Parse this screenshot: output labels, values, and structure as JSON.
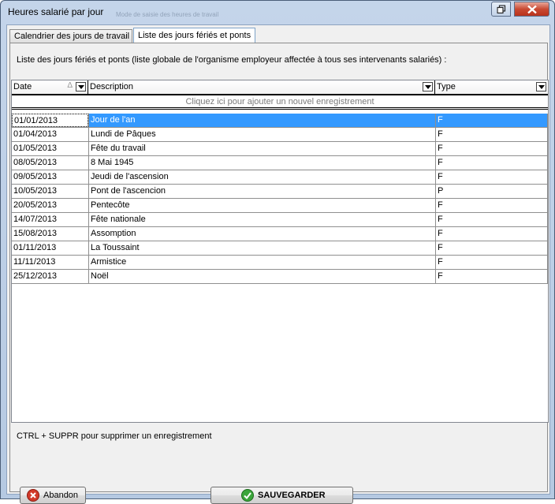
{
  "window": {
    "title": "Heures salarié par jour",
    "ghost_title": "Mode de saisie des heures de travail"
  },
  "tabs": [
    {
      "label": "Calendrier des jours de travail"
    },
    {
      "label": "Liste des jours fériés et ponts"
    }
  ],
  "intro": "Liste des jours fériés et ponts (liste globale de l'organisme employeur affectée à tous ses intervenants salariés) :",
  "grid": {
    "headers": [
      "Date",
      "Description",
      "Type"
    ],
    "sort_indicator": "Δ",
    "new_row_text": "Cliquez ici pour ajouter un nouvel enregistrement",
    "rows": [
      {
        "date": "01/01/2013",
        "description": "Jour de l'an",
        "type": "F",
        "selected": true
      },
      {
        "date": "01/04/2013",
        "description": "Lundi de Pâques",
        "type": "F"
      },
      {
        "date": "01/05/2013",
        "description": "Fête du travail",
        "type": "F"
      },
      {
        "date": "08/05/2013",
        "description": "8 Mai 1945",
        "type": "F"
      },
      {
        "date": "09/05/2013",
        "description": "Jeudi de l'ascension",
        "type": "F"
      },
      {
        "date": "10/05/2013",
        "description": "Pont de l'ascencion",
        "type": "P"
      },
      {
        "date": "20/05/2013",
        "description": "Pentecôte",
        "type": "F"
      },
      {
        "date": "14/07/2013",
        "description": "Fête nationale",
        "type": "F"
      },
      {
        "date": "15/08/2013",
        "description": "Assomption",
        "type": "F"
      },
      {
        "date": "01/11/2013",
        "description": "La Toussaint",
        "type": "F"
      },
      {
        "date": "11/11/2013",
        "description": "Armistice",
        "type": "F"
      },
      {
        "date": "25/12/2013",
        "description": "Noël",
        "type": "F"
      }
    ]
  },
  "hint": "CTRL + SUPPR pour supprimer un enregistrement",
  "buttons": {
    "cancel": "Abandon",
    "save": "SAUVEGARDER"
  },
  "colors": {
    "selection": "#3399ff",
    "close": "#c94a33",
    "save_icon": "#3aa53a",
    "cancel_icon": "#d23a2a"
  }
}
